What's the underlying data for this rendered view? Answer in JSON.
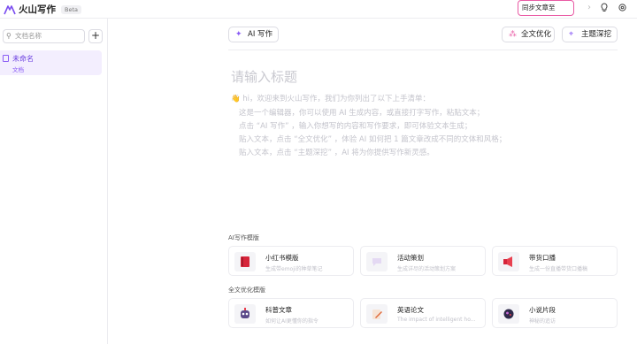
{
  "app": {
    "name": "火山写作",
    "badge": "Beta"
  },
  "topbar": {
    "sync_label": "同步文章至"
  },
  "sidebar": {
    "search_placeholder": "文档名称",
    "add_label": "+",
    "documents": [
      {
        "title": "未命名",
        "type": "文档"
      }
    ]
  },
  "toolbar": {
    "ai_write_label": "AI 写作",
    "optimize_label": "全文优化",
    "topic_label": "主题深挖"
  },
  "editor": {
    "title_placeholder": "请输入标题",
    "intro": [
      "hi，欢迎来到火山写作，我们为你列出了以下上手清单：",
      "这是一个编辑器，你可以使用 AI 生成内容，或直接打字写作，粘贴文本；",
      "点击 “AI 写作” ，输入你想写的内容和写作要求，即可体验文本生成；",
      "贴入文本，点击 “全文优化” ，体验 AI 如何把 1 篇文章改成不同的文体和风格；",
      "贴入文本，点击 “主题深挖” ，AI 将为你提供写作新灵感。"
    ],
    "intro_emoji": "👋"
  },
  "templates": {
    "ai_section_label": "AI写作模版",
    "ai_cards": [
      {
        "title": "小红书模版",
        "desc": "生成带emoji的种草笔记",
        "icon": "red-book-icon"
      },
      {
        "title": "活动策划",
        "desc": "生成详尽的活动策划方案",
        "icon": "chat-bubble-icon"
      },
      {
        "title": "带货口播",
        "desc": "生成一份直播带货口播稿",
        "icon": "megaphone-icon"
      }
    ],
    "optimize_section_label": "全文优化模版",
    "optimize_cards": [
      {
        "title": "科普文章",
        "desc": "如何让AI更懂你的指令",
        "icon": "robot-icon"
      },
      {
        "title": "英语论文",
        "desc": "The impact of intelligent ho...",
        "icon": "pencil-paper-icon"
      },
      {
        "title": "小说片段",
        "desc": "神秘的追访",
        "icon": "mystery-orb-icon"
      }
    ]
  },
  "colors": {
    "accent": "#8a5cf5",
    "sync_border": "#e95aa4"
  }
}
